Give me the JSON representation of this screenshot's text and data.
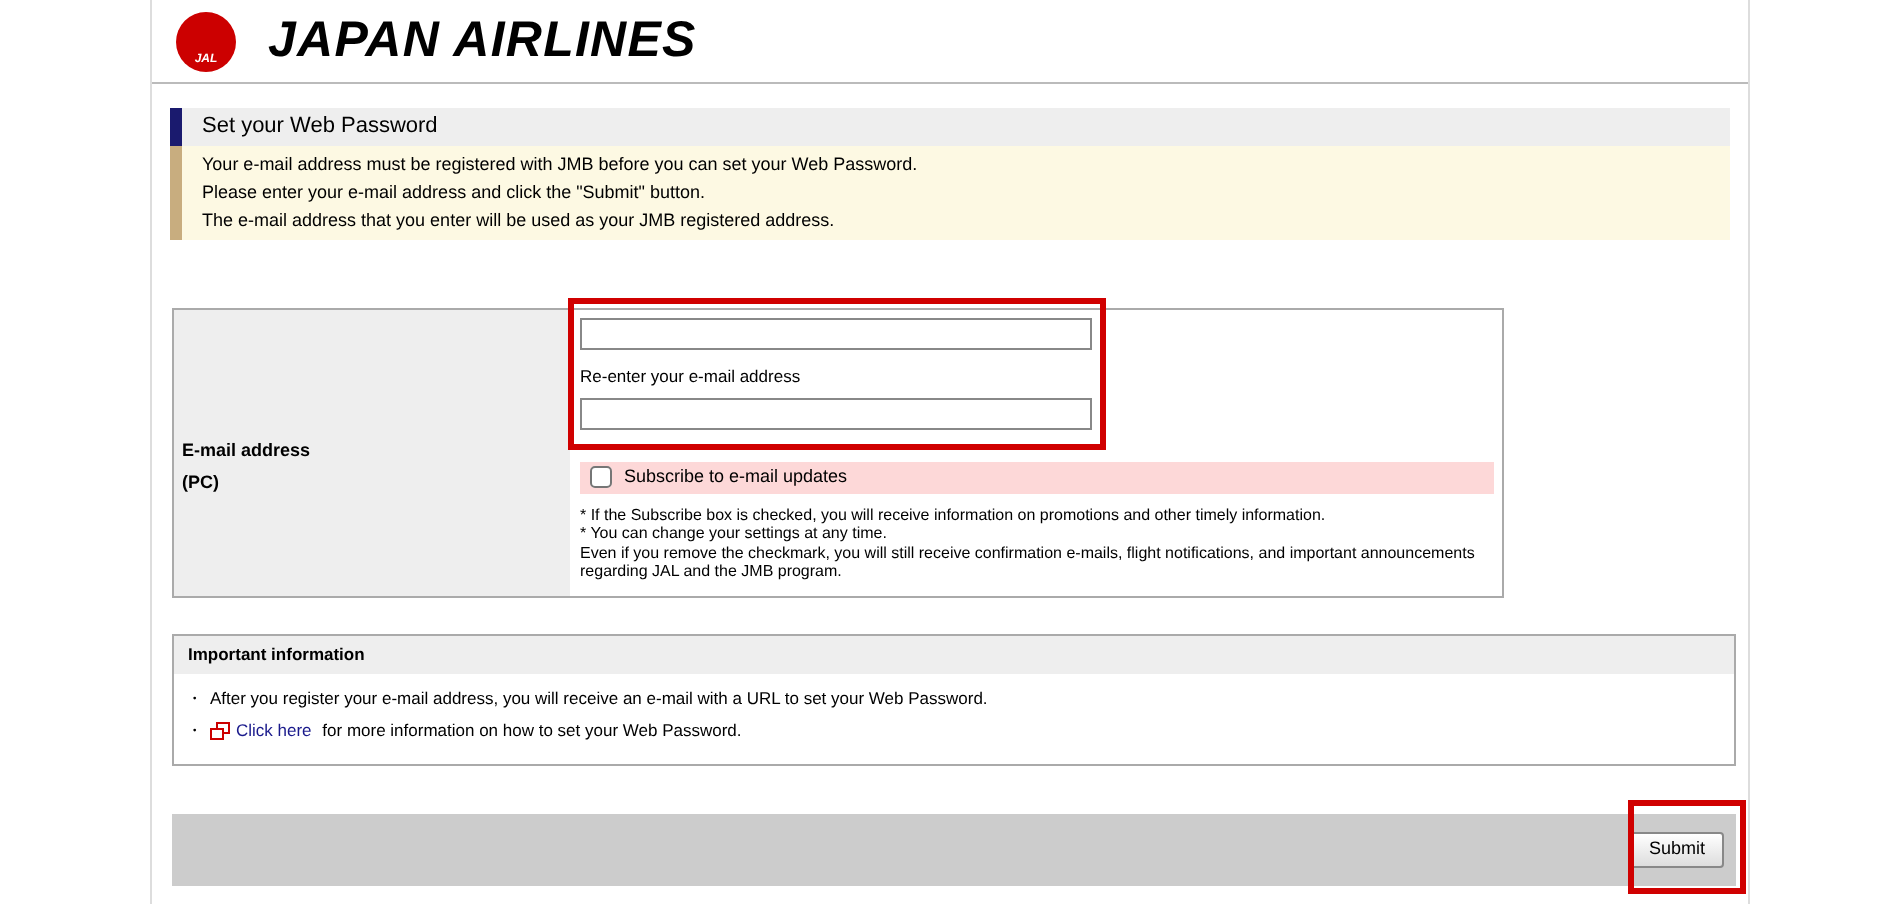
{
  "header": {
    "logo_mark": "JAL",
    "brand": "JAPAN AIRLINES"
  },
  "section": {
    "title": "Set your Web Password",
    "notice": [
      "Your e-mail address must be registered with JMB before you can set your Web Password.",
      "Please enter your e-mail address and click the \"Submit\" button.",
      "The e-mail address that you enter will be used as your JMB registered address."
    ]
  },
  "form": {
    "label": "E-mail address",
    "sublabel": "(PC)",
    "highlighted": true,
    "fields": [
      {
        "kind": "email"
      },
      {
        "kind": "email",
        "label": "Re-enter your e-mail address"
      }
    ],
    "subscribe": {
      "label": "Subscribe to e-mail updates",
      "checked": false
    },
    "notes": [
      "* If the Subscribe box is checked, you will receive information on promotions and other timely information.",
      "* You can change your settings at any time.",
      "Even if you remove the checkmark, you will still receive confirmation e-mails, flight notifications, and important announcements regarding JAL and the JMB program."
    ]
  },
  "important": {
    "title": "Important information",
    "items": [
      {
        "kind": "text",
        "bullet": "・",
        "text": "After you register your e-mail address, you will receive an e-mail with a URL to set your Web Password."
      },
      {
        "kind": "link",
        "bullet": "・",
        "link": "Click here",
        "text": " for more information on how to set your Web Password."
      }
    ]
  },
  "submit": {
    "label": "Submit",
    "highlighted": true
  }
}
